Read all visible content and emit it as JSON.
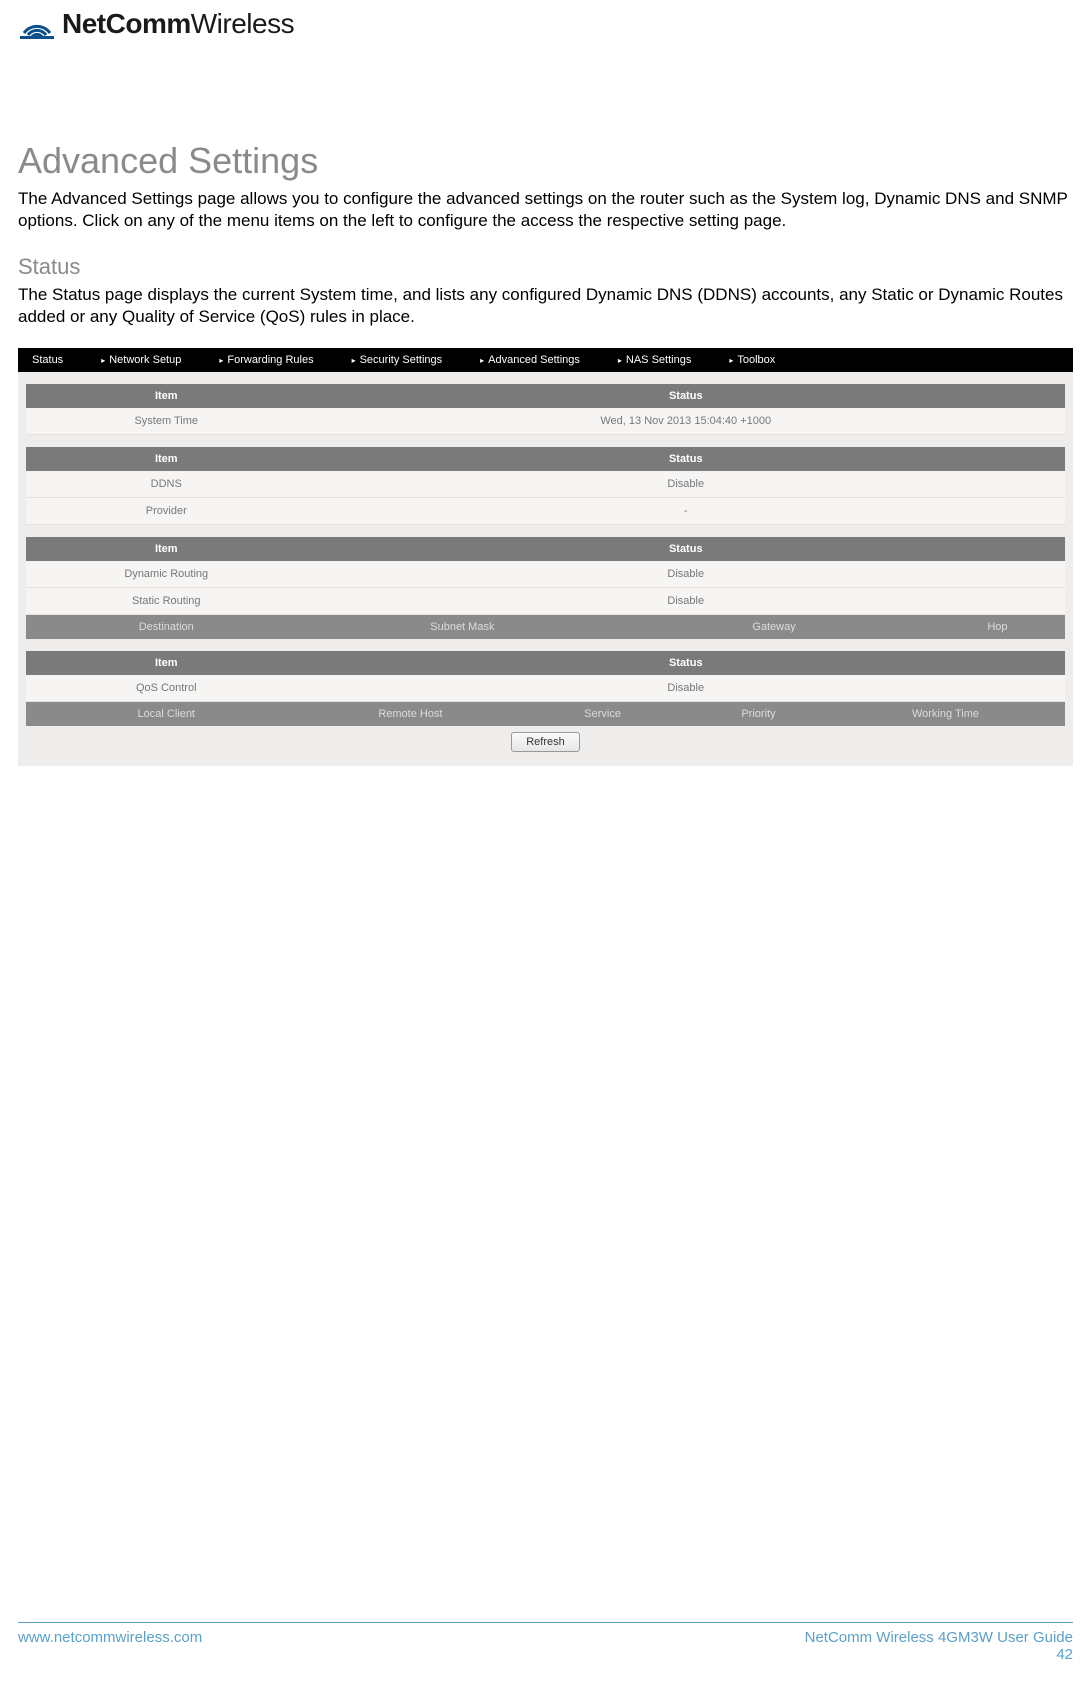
{
  "brand": {
    "name_bold": "NetComm",
    "name_light": "Wireless"
  },
  "heading": "Advanced Settings",
  "intro": "The Advanced Settings page allows you to configure the advanced settings on the router such as the System log, Dynamic DNS and SNMP options. Click on any of the menu items on the left to configure the access the respective setting page.",
  "status_heading": "Status",
  "status_intro": "The Status page displays the current System time, and lists any configured Dynamic DNS (DDNS) accounts, any Static or Dynamic Routes added or any Quality of Service (QoS) rules in place.",
  "nav": [
    "Status",
    "Network Setup",
    "Forwarding Rules",
    "Security Settings",
    "Advanced Settings",
    "NAS Settings",
    "Toolbox"
  ],
  "col_item": "Item",
  "col_status": "Status",
  "tbl1": {
    "r1_label": "System Time",
    "r1_val": "Wed, 13 Nov 2013 15:04:40 +1000"
  },
  "tbl2": {
    "r1_label": "DDNS",
    "r1_val": "Disable",
    "r2_label": "Provider",
    "r2_val": "-"
  },
  "tbl3": {
    "r1_label": "Dynamic Routing",
    "r1_val": "Disable",
    "r2_label": "Static Routing",
    "r2_val": "Disable",
    "sub": [
      "Destination",
      "Subnet Mask",
      "Gateway",
      "Hop"
    ]
  },
  "tbl4": {
    "r1_label": "QoS Control",
    "r1_val": "Disable",
    "sub": [
      "Local Client",
      "Remote Host",
      "Service",
      "Priority",
      "Working Time"
    ]
  },
  "refresh_label": "Refresh",
  "footer": {
    "url": "www.netcommwireless.com",
    "guide": "NetComm Wireless 4GM3W User Guide",
    "page": "42"
  }
}
